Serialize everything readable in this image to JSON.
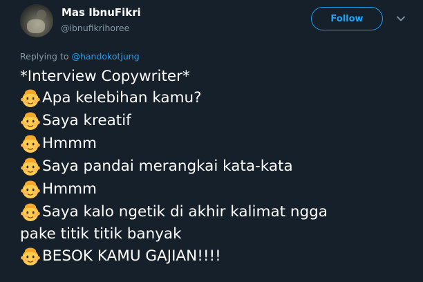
{
  "user": {
    "display_name": "Mas IbnuFikri",
    "handle": "@ibnufikrihoree"
  },
  "follow_button": {
    "label": "Follow"
  },
  "reply_context": {
    "prefix": "Replying to",
    "mention": "@handokotjung"
  },
  "colors": {
    "background": "#15202b",
    "accent": "#1da1f2",
    "secondary_text": "#8899a6"
  },
  "tweet": {
    "lines": [
      {
        "emoji": "",
        "text": "*Interview Copywriter*"
      },
      {
        "emoji": "baby-face-icon",
        "text": "Apa kelebihan kamu?"
      },
      {
        "emoji": "baby-face-icon",
        "text": "Saya kreatif"
      },
      {
        "emoji": "baby-face-icon",
        "text": "Hmmm"
      },
      {
        "emoji": "baby-face-icon",
        "text": "Saya pandai merangkai kata-kata"
      },
      {
        "emoji": "baby-face-icon",
        "text": "Hmmm"
      },
      {
        "emoji": "baby-face-icon",
        "text": "Saya kalo ngetik di akhir kalimat ngga"
      },
      {
        "emoji": "",
        "text": "pake titik titik banyak"
      },
      {
        "emoji": "baby-face-icon",
        "text": "BESOK KAMU GAJIAN!!!!"
      }
    ]
  }
}
